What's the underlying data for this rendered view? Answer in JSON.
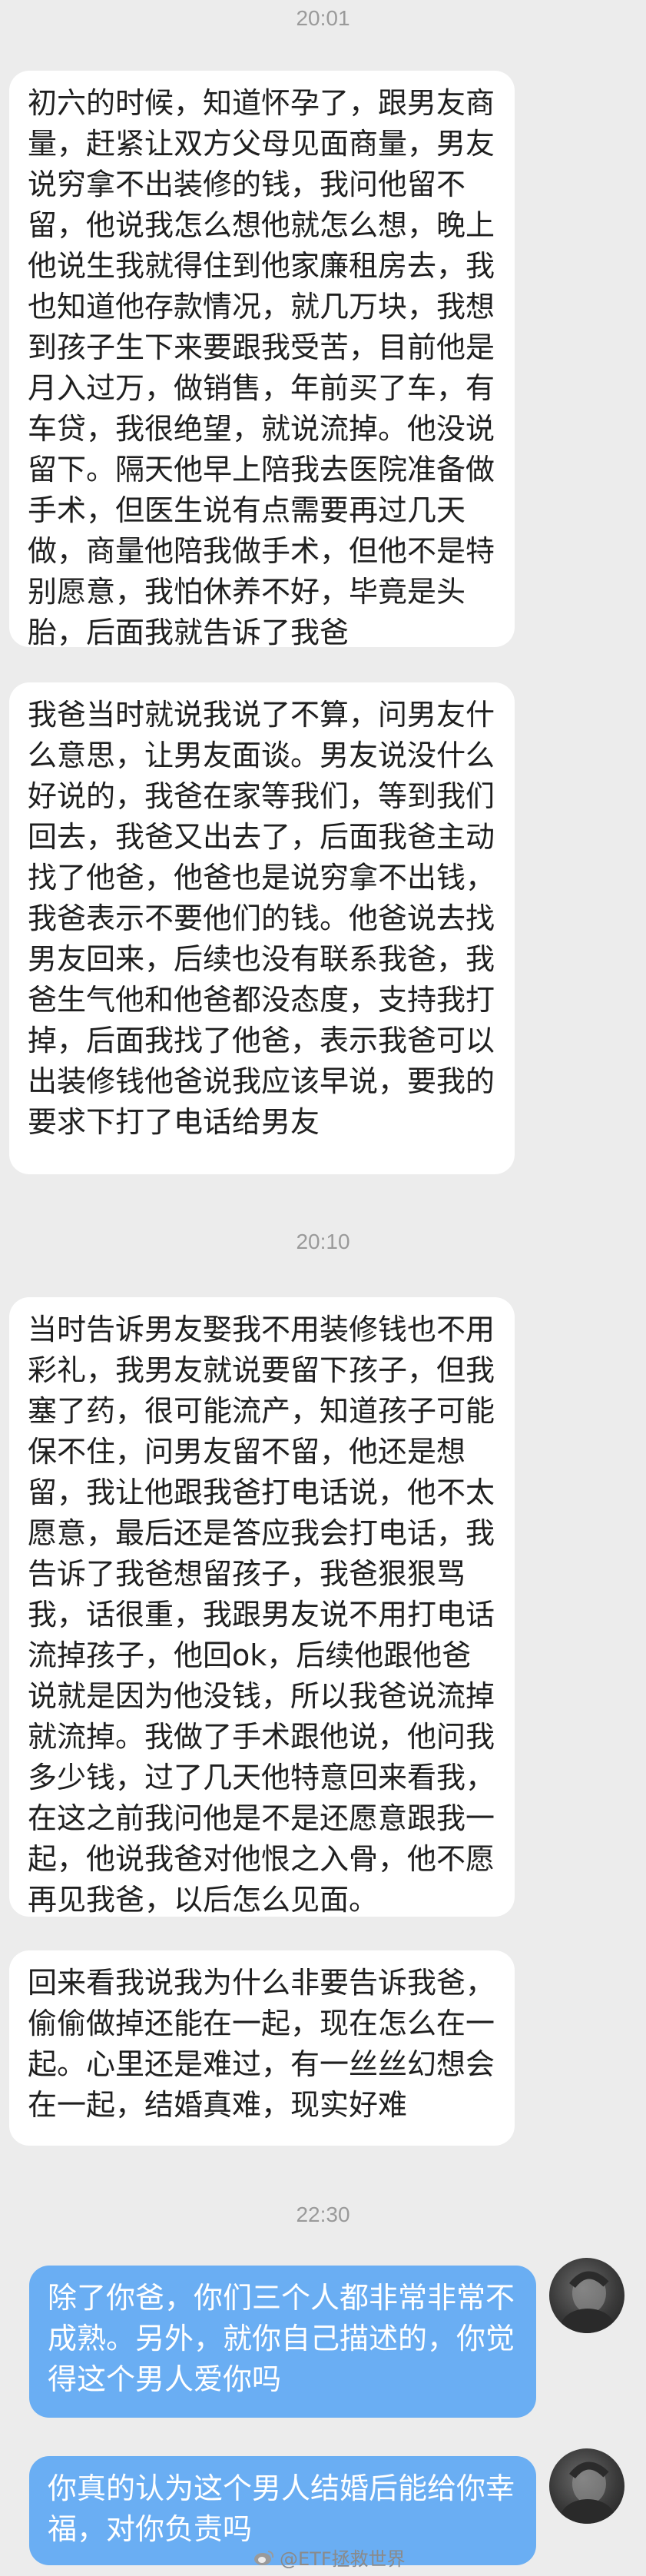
{
  "chat": {
    "times": [
      "20:01",
      "20:10",
      "22:30"
    ],
    "messages": [
      "初六的时候，知道怀孕了，跟男友商量，赶紧让双方父母见面商量，男友说穷拿不出装修的钱，我问他留不留，他说我怎么想他就怎么想，晚上他说生我就得住到他家廉租房去，我也知道他存款情况，就几万块，我想到孩子生下来要跟我受苦，目前他是月入过万，做销售，年前买了车，有车贷，我很绝望，就说流掉。他没说留下。隔天他早上陪我去医院准备做手术，但医生说有点需要再过几天做，商量他陪我做手术，但他不是特别愿意，我怕休养不好，毕竟是头胎，后面我就告诉了我爸",
      "我爸当时就说我说了不算，问男友什么意思，让男友面谈。男友说没什么好说的，我爸在家等我们，等到我们回去，我爸又出去了，后面我爸主动找了他爸，他爸也是说穷拿不出钱，我爸表示不要他们的钱。他爸说去找男友回来，后续也没有联系我爸，我爸生气他和他爸都没态度，支持我打掉，后面我找了他爸，表示我爸可以出装修钱他爸说我应该早说，要我的要求下打了电话给男友",
      "当时告诉男友娶我不用装修钱也不用彩礼，我男友就说要留下孩子，但我塞了药，很可能流产，知道孩子可能保不住，问男友留不留，他还是想留，我让他跟我爸打电话说，他不太愿意，最后还是答应我会打电话，我告诉了我爸想留孩子，我爸狠狠骂我，话很重，我跟男友说不用打电话流掉孩子，他回ok，后续他跟他爸说就是因为他没钱，所以我爸说流掉就流掉。我做了手术跟他说，他问我多少钱，过了几天他特意回来看我，在这之前我问他是不是还愿意跟我一起，他说我爸对他恨之入骨，他不愿再见我爸，以后怎么见面。",
      "回来看我说我为什么非要告诉我爸，偷偷做掉还能在一起，现在怎么在一起。心里还是难过，有一丝丝幻想会在一起，结婚真难，现实好难",
      "除了你爸，你们三个人都非常非常不成熟。另外，就你自己描述的，你觉得这个男人爱你吗",
      "你真的认为这个男人结婚后能给你幸福，对你负责吗"
    ]
  },
  "watermark": {
    "text": "@ETF拯救世界"
  },
  "colors": {
    "background": "#ececec",
    "incoming_bubble": "#ffffff",
    "outgoing_bubble": "#6aaef3"
  }
}
